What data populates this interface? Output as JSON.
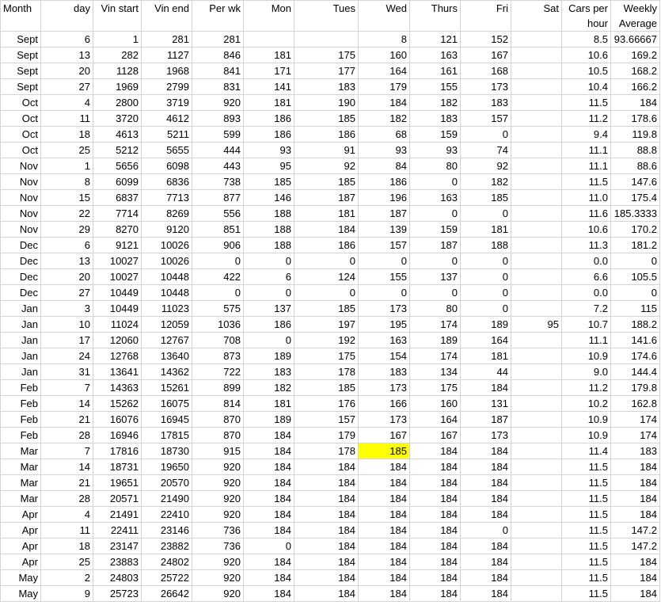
{
  "sheet": {
    "headers": [
      "Month",
      "day",
      "Vin start",
      "Vin end",
      "Per wk",
      "Mon",
      "Tues",
      "Wed",
      "Thurs",
      "Fri",
      "Sat",
      "Cars per hour",
      "Weekly Average"
    ],
    "rows": [
      [
        "Sept",
        "6",
        "1",
        "281",
        "281",
        "",
        "",
        "8",
        "121",
        "152",
        "",
        "8.5",
        "93.66667"
      ],
      [
        "Sept",
        "13",
        "282",
        "1127",
        "846",
        "181",
        "175",
        "160",
        "163",
        "167",
        "",
        "10.6",
        "169.2"
      ],
      [
        "Sept",
        "20",
        "1128",
        "1968",
        "841",
        "171",
        "177",
        "164",
        "161",
        "168",
        "",
        "10.5",
        "168.2"
      ],
      [
        "Sept",
        "27",
        "1969",
        "2799",
        "831",
        "141",
        "183",
        "179",
        "155",
        "173",
        "",
        "10.4",
        "166.2"
      ],
      [
        "Oct",
        "4",
        "2800",
        "3719",
        "920",
        "181",
        "190",
        "184",
        "182",
        "183",
        "",
        "11.5",
        "184"
      ],
      [
        "Oct",
        "11",
        "3720",
        "4612",
        "893",
        "186",
        "185",
        "182",
        "183",
        "157",
        "",
        "11.2",
        "178.6"
      ],
      [
        "Oct",
        "18",
        "4613",
        "5211",
        "599",
        "186",
        "186",
        "68",
        "159",
        "0",
        "",
        "9.4",
        "119.8"
      ],
      [
        "Oct",
        "25",
        "5212",
        "5655",
        "444",
        "93",
        "91",
        "93",
        "93",
        "74",
        "",
        "11.1",
        "88.8"
      ],
      [
        "Nov",
        "1",
        "5656",
        "6098",
        "443",
        "95",
        "92",
        "84",
        "80",
        "92",
        "",
        "11.1",
        "88.6"
      ],
      [
        "Nov",
        "8",
        "6099",
        "6836",
        "738",
        "185",
        "185",
        "186",
        "0",
        "182",
        "",
        "11.5",
        "147.6"
      ],
      [
        "Nov",
        "15",
        "6837",
        "7713",
        "877",
        "146",
        "187",
        "196",
        "163",
        "185",
        "",
        "11.0",
        "175.4"
      ],
      [
        "Nov",
        "22",
        "7714",
        "8269",
        "556",
        "188",
        "181",
        "187",
        "0",
        "0",
        "",
        "11.6",
        "185.3333"
      ],
      [
        "Nov",
        "29",
        "8270",
        "9120",
        "851",
        "188",
        "184",
        "139",
        "159",
        "181",
        "",
        "10.6",
        "170.2"
      ],
      [
        "Dec",
        "6",
        "9121",
        "10026",
        "906",
        "188",
        "186",
        "157",
        "187",
        "188",
        "",
        "11.3",
        "181.2"
      ],
      [
        "Dec",
        "13",
        "10027",
        "10026",
        "0",
        "0",
        "0",
        "0",
        "0",
        "0",
        "",
        "0.0",
        "0"
      ],
      [
        "Dec",
        "20",
        "10027",
        "10448",
        "422",
        "6",
        "124",
        "155",
        "137",
        "0",
        "",
        "6.6",
        "105.5"
      ],
      [
        "Dec",
        "27",
        "10449",
        "10448",
        "0",
        "0",
        "0",
        "0",
        "0",
        "0",
        "",
        "0.0",
        "0"
      ],
      [
        "Jan",
        "3",
        "10449",
        "11023",
        "575",
        "137",
        "185",
        "173",
        "80",
        "0",
        "",
        "7.2",
        "115"
      ],
      [
        "Jan",
        "10",
        "11024",
        "12059",
        "1036",
        "186",
        "197",
        "195",
        "174",
        "189",
        "95",
        "10.7",
        "188.2"
      ],
      [
        "Jan",
        "17",
        "12060",
        "12767",
        "708",
        "0",
        "192",
        "163",
        "189",
        "164",
        "",
        "11.1",
        "141.6"
      ],
      [
        "Jan",
        "24",
        "12768",
        "13640",
        "873",
        "189",
        "175",
        "154",
        "174",
        "181",
        "",
        "10.9",
        "174.6"
      ],
      [
        "Jan",
        "31",
        "13641",
        "14362",
        "722",
        "183",
        "178",
        "183",
        "134",
        "44",
        "",
        "9.0",
        "144.4"
      ],
      [
        "Feb",
        "7",
        "14363",
        "15261",
        "899",
        "182",
        "185",
        "173",
        "175",
        "184",
        "",
        "11.2",
        "179.8"
      ],
      [
        "Feb",
        "14",
        "15262",
        "16075",
        "814",
        "181",
        "176",
        "166",
        "160",
        "131",
        "",
        "10.2",
        "162.8"
      ],
      [
        "Feb",
        "21",
        "16076",
        "16945",
        "870",
        "189",
        "157",
        "173",
        "164",
        "187",
        "",
        "10.9",
        "174"
      ],
      [
        "Feb",
        "28",
        "16946",
        "17815",
        "870",
        "184",
        "179",
        "167",
        "167",
        "173",
        "",
        "10.9",
        "174"
      ],
      [
        "Mar",
        "7",
        "17816",
        "18730",
        "915",
        "184",
        "178",
        "185",
        "184",
        "184",
        "",
        "11.4",
        "183"
      ],
      [
        "Mar",
        "14",
        "18731",
        "19650",
        "920",
        "184",
        "184",
        "184",
        "184",
        "184",
        "",
        "11.5",
        "184"
      ],
      [
        "Mar",
        "21",
        "19651",
        "20570",
        "920",
        "184",
        "184",
        "184",
        "184",
        "184",
        "",
        "11.5",
        "184"
      ],
      [
        "Mar",
        "28",
        "20571",
        "21490",
        "920",
        "184",
        "184",
        "184",
        "184",
        "184",
        "",
        "11.5",
        "184"
      ],
      [
        "Apr",
        "4",
        "21491",
        "22410",
        "920",
        "184",
        "184",
        "184",
        "184",
        "184",
        "",
        "11.5",
        "184"
      ],
      [
        "Apr",
        "11",
        "22411",
        "23146",
        "736",
        "184",
        "184",
        "184",
        "184",
        "0",
        "",
        "11.5",
        "147.2"
      ],
      [
        "Apr",
        "18",
        "23147",
        "23882",
        "736",
        "0",
        "184",
        "184",
        "184",
        "184",
        "",
        "11.5",
        "147.2"
      ],
      [
        "Apr",
        "25",
        "23883",
        "24802",
        "920",
        "184",
        "184",
        "184",
        "184",
        "184",
        "",
        "11.5",
        "184"
      ],
      [
        "May",
        "2",
        "24803",
        "25722",
        "920",
        "184",
        "184",
        "184",
        "184",
        "184",
        "",
        "11.5",
        "184"
      ],
      [
        "May",
        "9",
        "25723",
        "26642",
        "920",
        "184",
        "184",
        "184",
        "184",
        "184",
        "",
        "11.5",
        "184"
      ]
    ],
    "highlight": {
      "row": 26,
      "col": 7,
      "color": "#ffff00"
    }
  }
}
